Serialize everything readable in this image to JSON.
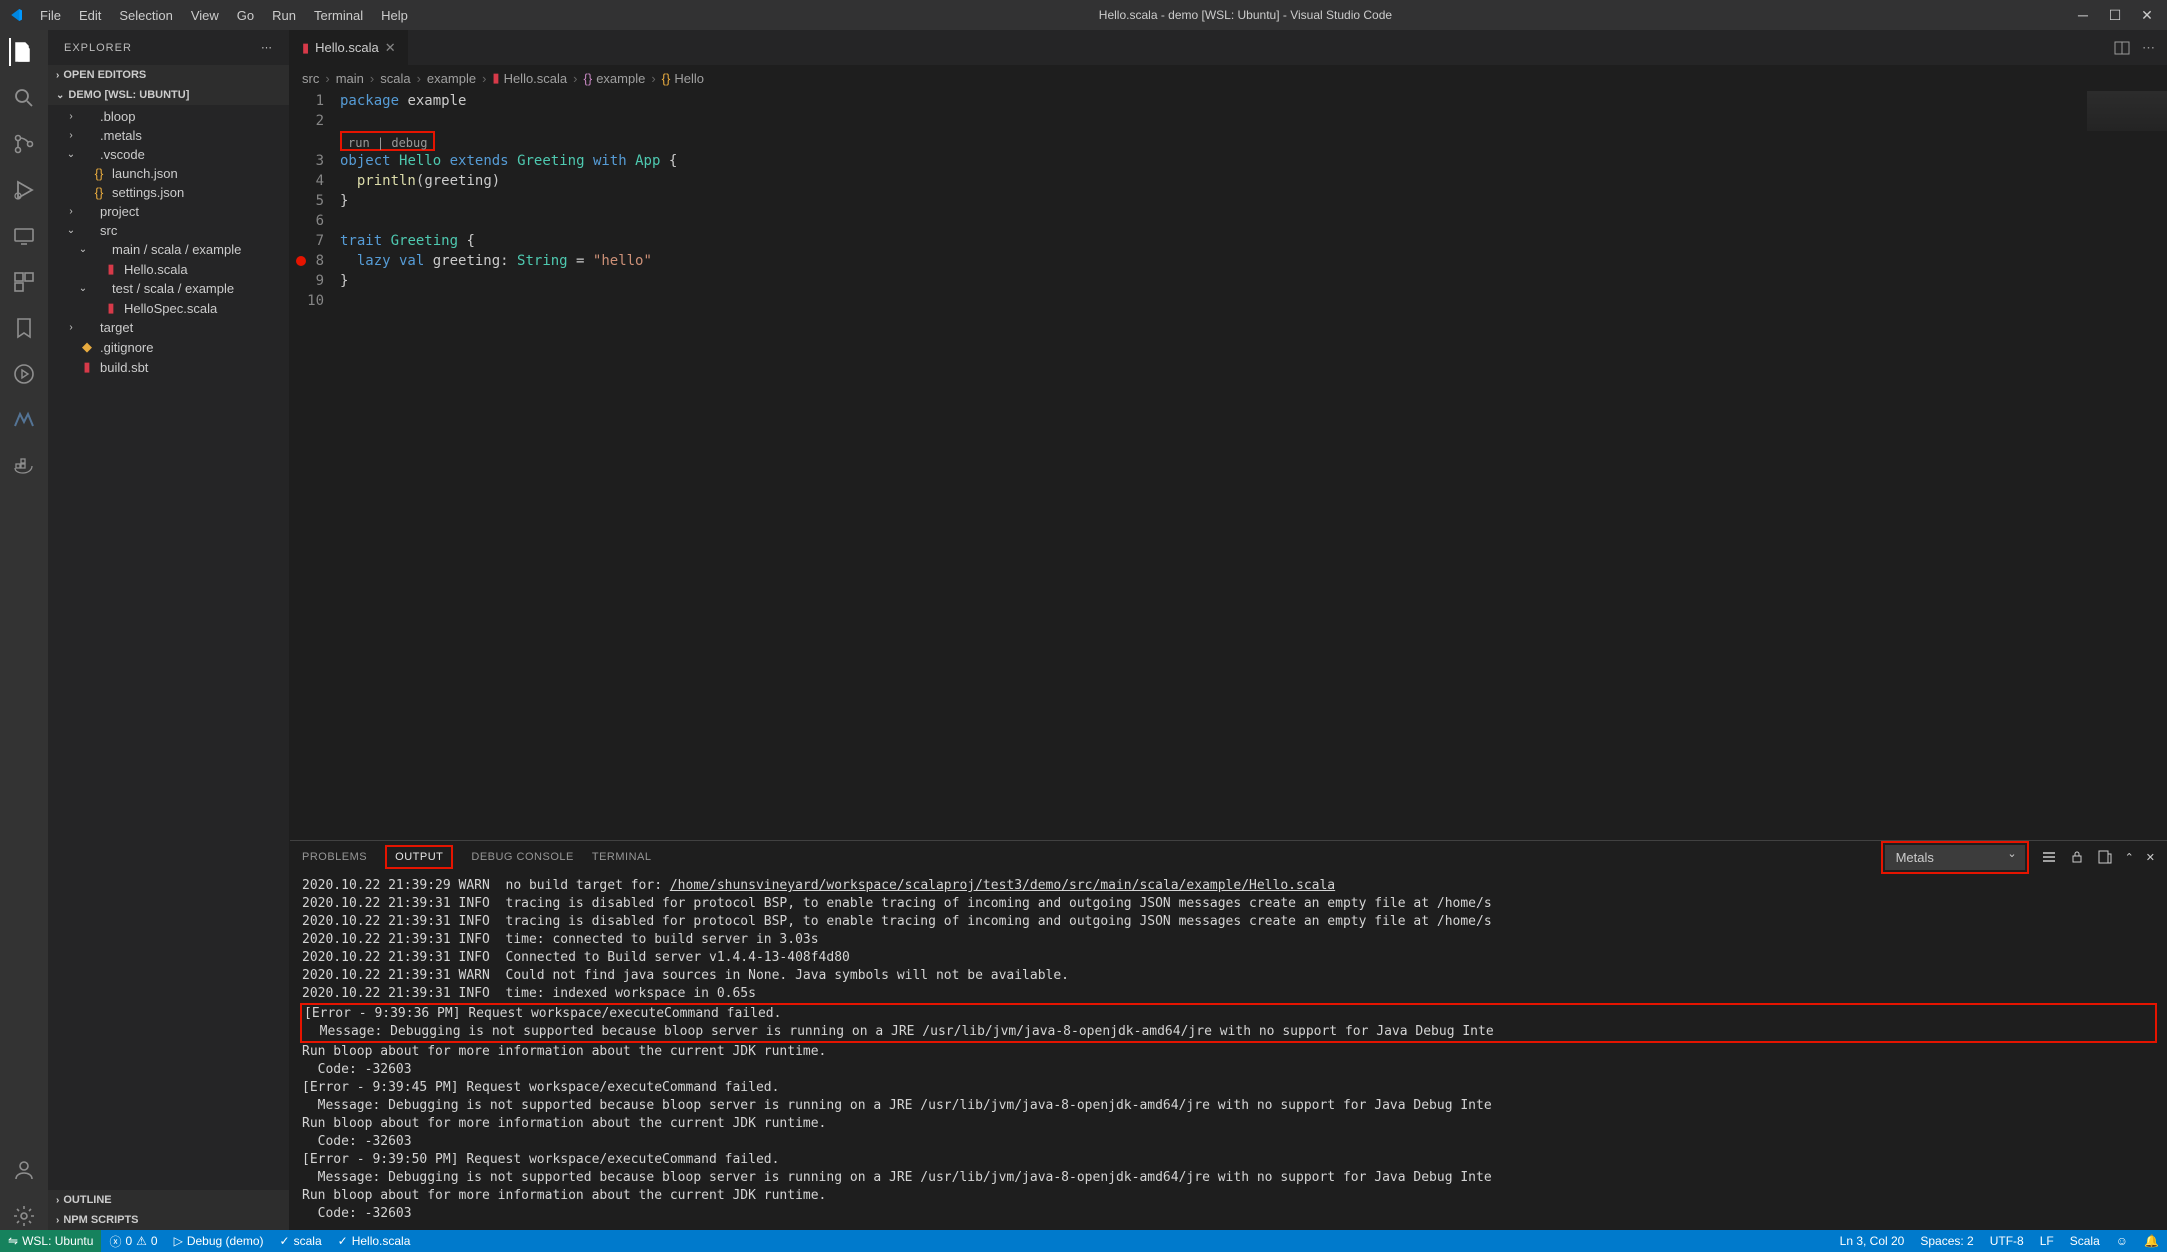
{
  "window": {
    "title": "Hello.scala - demo [WSL: Ubuntu] - Visual Studio Code"
  },
  "menu": [
    "File",
    "Edit",
    "Selection",
    "View",
    "Go",
    "Run",
    "Terminal",
    "Help"
  ],
  "sidebar": {
    "title": "EXPLORER",
    "sections": {
      "open_editors": "OPEN EDITORS",
      "workspace": "DEMO [WSL: UBUNTU]",
      "outline": "OUTLINE",
      "npm": "NPM SCRIPTS"
    },
    "tree": [
      {
        "label": ".bloop",
        "type": "folder",
        "indent": 1,
        "open": false
      },
      {
        "label": ".metals",
        "type": "folder",
        "indent": 1,
        "open": false
      },
      {
        "label": ".vscode",
        "type": "folder",
        "indent": 1,
        "open": true
      },
      {
        "label": "launch.json",
        "type": "json",
        "indent": 2
      },
      {
        "label": "settings.json",
        "type": "json",
        "indent": 2
      },
      {
        "label": "project",
        "type": "folder",
        "indent": 1,
        "open": false
      },
      {
        "label": "src",
        "type": "folder",
        "indent": 1,
        "open": true
      },
      {
        "label": "main / scala / example",
        "type": "folder",
        "indent": 2,
        "open": true
      },
      {
        "label": "Hello.scala",
        "type": "scala",
        "indent": 3
      },
      {
        "label": "test / scala / example",
        "type": "folder",
        "indent": 2,
        "open": true
      },
      {
        "label": "HelloSpec.scala",
        "type": "scala",
        "indent": 3
      },
      {
        "label": "target",
        "type": "folder",
        "indent": 1,
        "open": false
      },
      {
        "label": ".gitignore",
        "type": "git",
        "indent": 1
      },
      {
        "label": "build.sbt",
        "type": "scala",
        "indent": 1
      }
    ]
  },
  "tabs": {
    "active": {
      "label": "Hello.scala"
    }
  },
  "breadcrumbs": [
    "src",
    "main",
    "scala",
    "example",
    "Hello.scala",
    "example",
    "Hello"
  ],
  "codelens": "run | debug",
  "code": {
    "lines": [
      {
        "n": 1,
        "html": "<span class='kw'>package</span> example"
      },
      {
        "n": 2,
        "html": ""
      },
      {
        "n": "",
        "html": ""
      },
      {
        "n": 3,
        "html": "<span class='kw'>object</span> <span class='type'>Hello</span> <span class='kw'>extends</span> <span class='type'>Greeting</span> <span class='kw'>with</span> <span class='type'>App</span> {"
      },
      {
        "n": 4,
        "html": "  <span class='fn'>println</span>(<span>greeting</span>)"
      },
      {
        "n": 5,
        "html": "}"
      },
      {
        "n": 6,
        "html": ""
      },
      {
        "n": 7,
        "html": "<span class='kw'>trait</span> <span class='type'>Greeting</span> {"
      },
      {
        "n": 8,
        "html": "  <span class='kw'>lazy val</span> <span>greeting</span>: <span class='type'>String</span> = <span class='str'>\"hello\"</span>"
      },
      {
        "n": 9,
        "html": "}"
      },
      {
        "n": 10,
        "html": ""
      }
    ],
    "breakpoint_line": 8
  },
  "panel": {
    "tabs": [
      "PROBLEMS",
      "OUTPUT",
      "DEBUG CONSOLE",
      "TERMINAL"
    ],
    "active_tab": "OUTPUT",
    "channel": "Metals",
    "output": [
      "2020.10.22 21:39:29 WARN  no build target for: /home/shunsvineyard/workspace/scalaproj/test3/demo/src/main/scala/example/Hello.scala",
      "2020.10.22 21:39:31 INFO  tracing is disabled for protocol BSP, to enable tracing of incoming and outgoing JSON messages create an empty file at /home/s",
      "2020.10.22 21:39:31 INFO  tracing is disabled for protocol BSP, to enable tracing of incoming and outgoing JSON messages create an empty file at /home/s",
      "2020.10.22 21:39:31 INFO  time: connected to build server in 3.03s",
      "2020.10.22 21:39:31 INFO  Connected to Build server v1.4.4-13-408f4d80",
      "2020.10.22 21:39:31 WARN  Could not find java sources in None. Java symbols will not be available.",
      "2020.10.22 21:39:31 INFO  time: indexed workspace in 0.65s",
      "[Error - 9:39:36 PM] Request workspace/executeCommand failed.",
      "  Message: Debugging is not supported because bloop server is running on a JRE /usr/lib/jvm/java-8-openjdk-amd64/jre with no support for Java Debug Inte",
      "",
      "Run bloop about for more information about the current JDK runtime.",
      "  Code: -32603",
      "[Error - 9:39:45 PM] Request workspace/executeCommand failed.",
      "  Message: Debugging is not supported because bloop server is running on a JRE /usr/lib/jvm/java-8-openjdk-amd64/jre with no support for Java Debug Inte",
      "",
      "Run bloop about for more information about the current JDK runtime.",
      "  Code: -32603",
      "[Error - 9:39:50 PM] Request workspace/executeCommand failed.",
      "  Message: Debugging is not supported because bloop server is running on a JRE /usr/lib/jvm/java-8-openjdk-amd64/jre with no support for Java Debug Inte",
      "",
      "Run bloop about for more information about the current JDK runtime.",
      "  Code: -32603"
    ]
  },
  "status": {
    "remote": "WSL: Ubuntu",
    "errors": "0",
    "warnings": "0",
    "debug": "Debug  (demo)",
    "scala_status": "scala",
    "file_status": "Hello.scala",
    "cursor": "Ln 3, Col 20",
    "spaces": "Spaces: 2",
    "encoding": "UTF-8",
    "eol": "LF",
    "lang": "Scala"
  }
}
